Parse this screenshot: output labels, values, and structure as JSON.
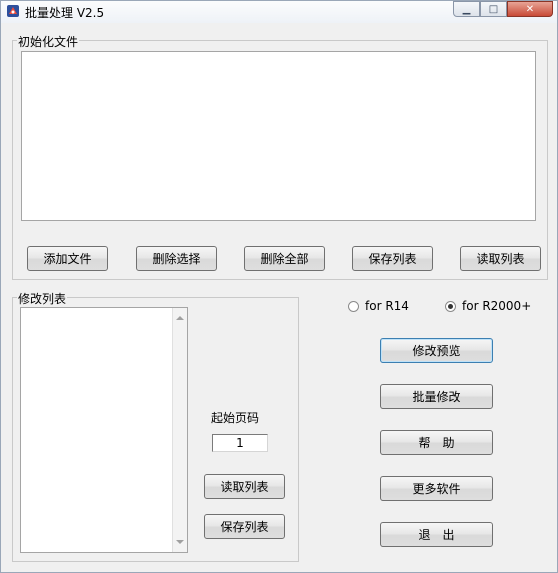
{
  "window": {
    "title": "批量处理 V2.5"
  },
  "init_group": {
    "legend": "初始化文件",
    "buttons": {
      "add": "添加文件",
      "delete_selected": "删除选择",
      "delete_all": "删除全部",
      "save_list": "保存列表",
      "read_list": "读取列表"
    }
  },
  "modify_group": {
    "legend": "修改列表",
    "start_page_label": "起始页码",
    "start_page_value": "1",
    "read_list": "读取列表",
    "save_list": "保存列表"
  },
  "options": {
    "r14_label": "for R14",
    "r2000_label": "for R2000+",
    "selected": "r2000"
  },
  "actions": {
    "preview": "修改预览",
    "batch": "批量修改",
    "help": "帮　助",
    "more": "更多软件",
    "exit": "退　出"
  },
  "icons": {
    "minimize": "minimize-icon",
    "maximize": "maximize-icon",
    "close": "close-icon"
  }
}
